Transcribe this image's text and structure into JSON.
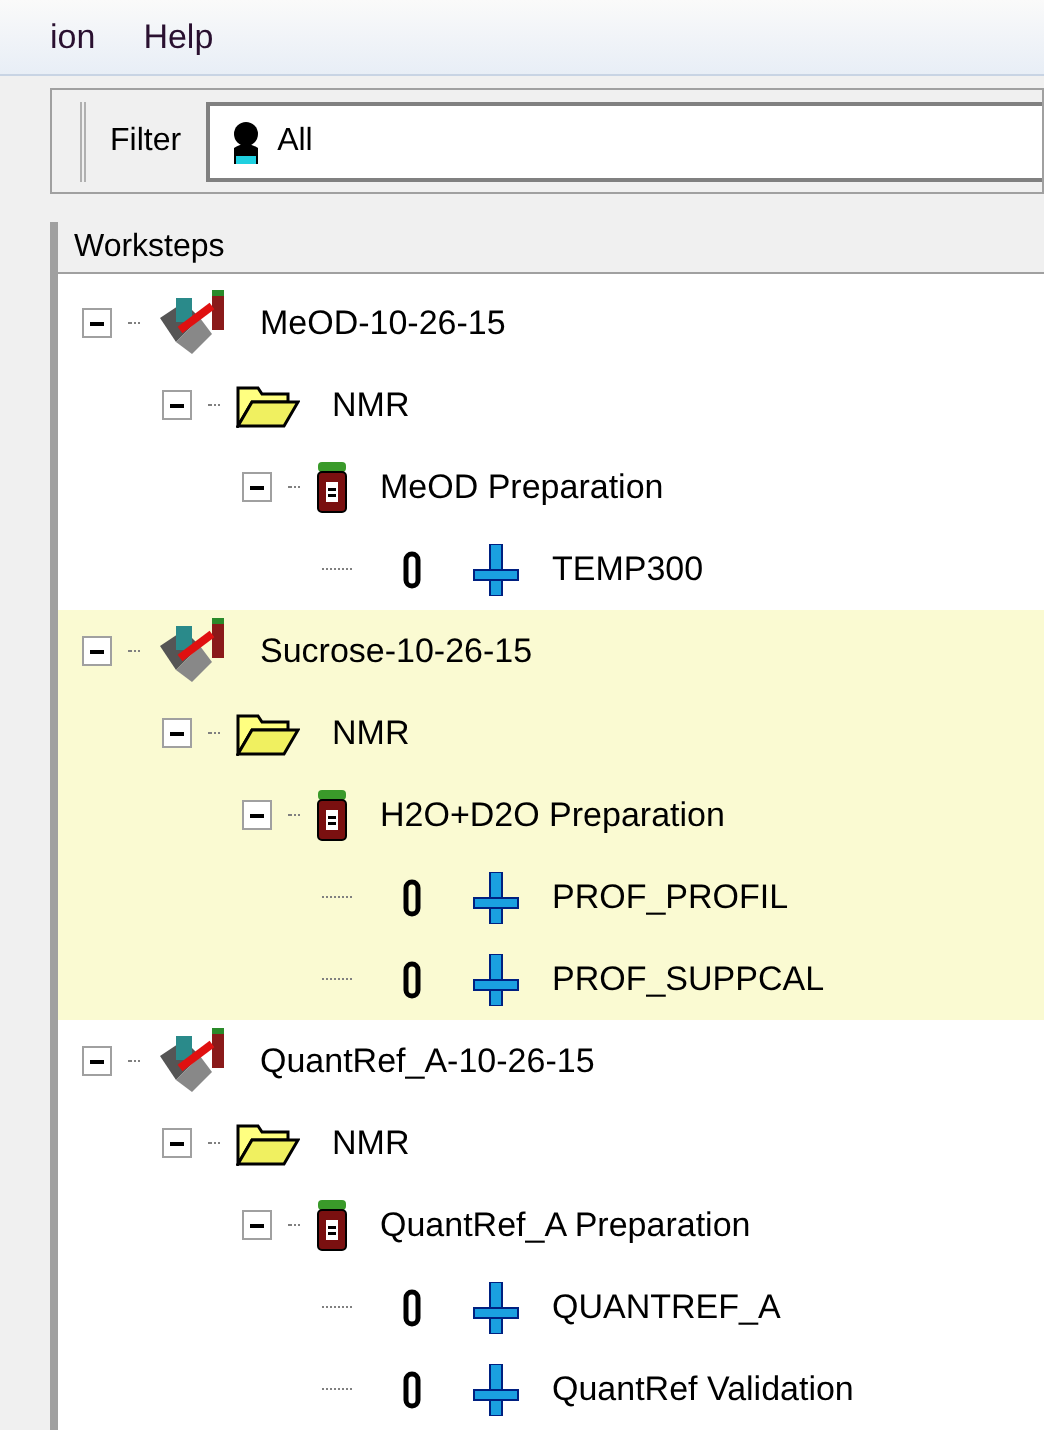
{
  "menu": [
    {
      "label": "ion"
    },
    {
      "label": "Help"
    }
  ],
  "filter": {
    "label": "Filter",
    "value": "All"
  },
  "tree": {
    "header": "Worksteps",
    "items": [
      {
        "kind": "sample",
        "label": "MeOD-10-26-15",
        "selected": false,
        "expanded": true,
        "children": [
          {
            "kind": "folder",
            "label": "NMR",
            "expanded": true,
            "children": [
              {
                "kind": "preparation",
                "label": "MeOD Preparation",
                "expanded": true,
                "children": [
                  {
                    "kind": "step",
                    "label": "TEMP300"
                  }
                ]
              }
            ]
          }
        ]
      },
      {
        "kind": "sample",
        "label": "Sucrose-10-26-15",
        "selected": true,
        "expanded": true,
        "children": [
          {
            "kind": "folder",
            "label": "NMR",
            "expanded": true,
            "children": [
              {
                "kind": "preparation",
                "label": "H2O+D2O Preparation",
                "expanded": true,
                "children": [
                  {
                    "kind": "step",
                    "label": "PROF_PROFIL"
                  },
                  {
                    "kind": "step",
                    "label": "PROF_SUPPCAL"
                  }
                ]
              }
            ]
          }
        ]
      },
      {
        "kind": "sample",
        "label": "QuantRef_A-10-26-15",
        "selected": false,
        "expanded": true,
        "children": [
          {
            "kind": "folder",
            "label": "NMR",
            "expanded": true,
            "children": [
              {
                "kind": "preparation",
                "label": "QuantRef_A Preparation",
                "expanded": true,
                "children": [
                  {
                    "kind": "step",
                    "label": "QUANTREF_A"
                  },
                  {
                    "kind": "step",
                    "label": "QuantRef Validation"
                  }
                ]
              }
            ]
          }
        ]
      }
    ]
  }
}
